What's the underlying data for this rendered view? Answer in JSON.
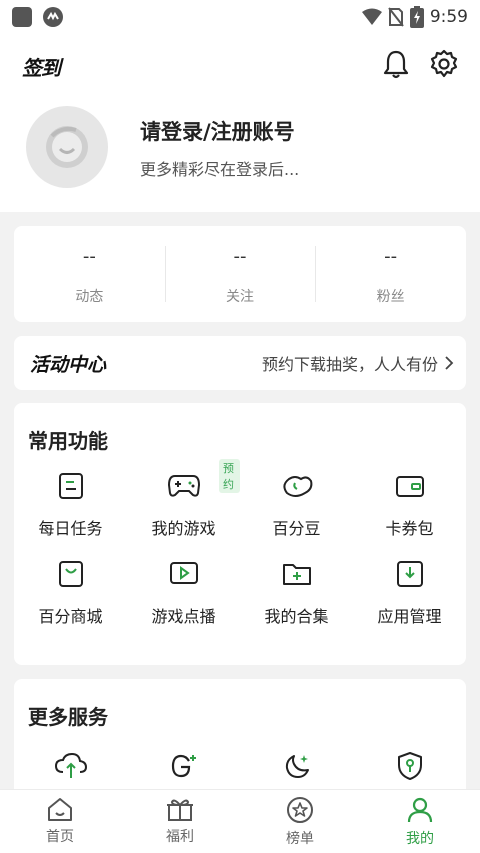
{
  "status_bar": {
    "time": "9:59"
  },
  "header": {
    "signin_label": "签到",
    "bell_icon": "bell-icon",
    "settings_icon": "gear-icon"
  },
  "profile": {
    "title": "请登录/注册账号",
    "subtitle": "更多精彩尽在登录后..."
  },
  "stats": [
    {
      "value": "--",
      "label": "动态"
    },
    {
      "value": "--",
      "label": "关注"
    },
    {
      "value": "--",
      "label": "粉丝"
    }
  ],
  "activity": {
    "title": "活动中心",
    "promo": "预约下载抽奖，人人有份"
  },
  "common": {
    "title": "常用功能",
    "items": [
      {
        "label": "每日任务",
        "icon": "task-list-icon"
      },
      {
        "label": "我的游戏",
        "icon": "gamepad-icon",
        "badge": "预约"
      },
      {
        "label": "百分豆",
        "icon": "bean-icon"
      },
      {
        "label": "卡券包",
        "icon": "wallet-icon"
      },
      {
        "label": "百分商城",
        "icon": "shopping-bag-icon"
      },
      {
        "label": "游戏点播",
        "icon": "play-video-icon"
      },
      {
        "label": "我的合集",
        "icon": "folder-add-icon"
      },
      {
        "label": "应用管理",
        "icon": "download-box-icon"
      }
    ]
  },
  "more": {
    "title": "更多服务",
    "items": [
      {
        "icon": "cloud-upload-icon"
      },
      {
        "icon": "google-plus-icon"
      },
      {
        "icon": "moon-star-icon"
      },
      {
        "icon": "shield-key-icon"
      }
    ]
  },
  "tabs": [
    {
      "label": "首页",
      "icon": "home-icon",
      "active": false
    },
    {
      "label": "福利",
      "icon": "gift-icon",
      "active": false
    },
    {
      "label": "榜单",
      "icon": "star-badge-icon",
      "active": false
    },
    {
      "label": "我的",
      "icon": "user-icon",
      "active": true
    }
  ],
  "colors": {
    "accent": "#2f9e46",
    "badge_bg": "#e3f5e6"
  }
}
